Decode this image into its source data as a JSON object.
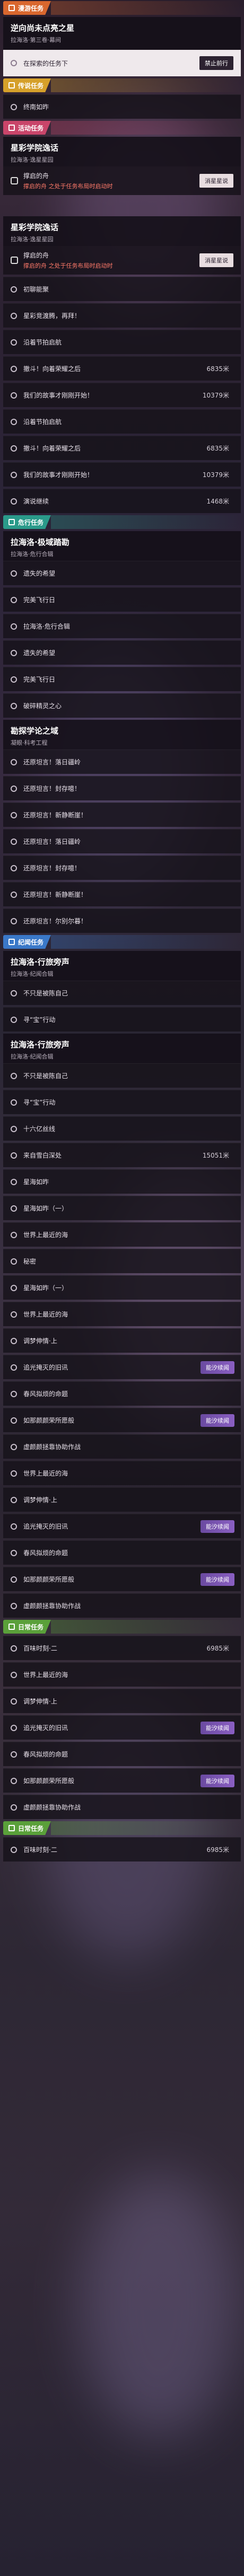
{
  "categories": {
    "explore": "漫游任务",
    "legend": "传说任务",
    "event": "活动任务",
    "urgent": "危行任务",
    "daily": "日常任务",
    "reconnaissance": "纪闻任务"
  },
  "explore_main": {
    "title": "逆向尚未点亮之星",
    "subtitle": "拉海洛·第三卷·幕间",
    "selected": "在探索的任务下",
    "selected_btn": "禁止前行"
  },
  "legend_item": "终南如昨",
  "event_main": {
    "title": "星彩学院逸话",
    "subtitle": "拉海洛·逸星星园"
  },
  "event_sub": {
    "label": "撑启的舟",
    "warn": "撑启的舟 之处于任务布局时启动时",
    "btn": "消星星说"
  },
  "event_main2": {
    "title": "星彩学院逸话",
    "subtitle": "拉海洛·逸星星园"
  },
  "event_sub2": {
    "label": "撑启的舟",
    "warn": "撑启的舟 之处于任务布局时启动时",
    "btn": "消星星说"
  },
  "event_items": [
    {
      "text": "初聊能聚"
    },
    {
      "text": "星彩竞渡腾，再拜！"
    },
    {
      "text": "沿着节拍启航"
    },
    {
      "text": "撤斗！向着荣耀之后",
      "dist": "6835米"
    },
    {
      "text": "我们的故事才刚刚开始！",
      "dist": "10379米"
    },
    {
      "text": "沿着节拍启航"
    },
    {
      "text": "撤斗！向着荣耀之后",
      "dist": "6835米"
    },
    {
      "text": "我们的故事才刚刚开始！",
      "dist": "10379米"
    },
    {
      "text": "演说继续",
      "dist": "1468米"
    }
  ],
  "urgent_main": {
    "title": "拉海洛·极域踏勘",
    "subtitle": "拉海洛·危行合辑"
  },
  "urgent_items": [
    {
      "text": "遗失的希望"
    },
    {
      "text": "完美飞行日"
    },
    {
      "text": "拉海洛·危行合辑"
    },
    {
      "text": "遗失的希望"
    },
    {
      "text": "完美飞行日"
    },
    {
      "text": "破碎精灵之心"
    }
  ],
  "urgent_main2": {
    "title": "勘探学论之域",
    "subtitle": "凝眼·科考工程"
  },
  "urgent_items2": [
    {
      "text": "还原坦言！落日疆岭"
    },
    {
      "text": "还原坦言！封存噫！"
    },
    {
      "text": "还原坦言！新静断崖！"
    },
    {
      "text": "还原坦言！落日疆岭"
    },
    {
      "text": "还原坦言！封存噫！"
    },
    {
      "text": "还原坦言！新静断崖！"
    },
    {
      "text": "还原坦言！尔别尔暮！"
    }
  ],
  "recon_main": {
    "title": "拉海洛·行旅旁声",
    "subtitle": "拉海洛·纪闻合辑"
  },
  "recon_items": [
    {
      "text": "不只是被陈自己"
    },
    {
      "text": "寻“宝”行动"
    }
  ],
  "recon_main2": {
    "title": "拉海洛·行旅旁声",
    "subtitle": "拉海洛·纪闻合辑"
  },
  "recon_items2": [
    {
      "text": "不只是被陈自己"
    },
    {
      "text": "寻“宝”行动"
    },
    {
      "text": "十六亿丝线"
    },
    {
      "text": "来自雪白深处",
      "dist": "15051米"
    },
    {
      "text": "星海如昨"
    },
    {
      "text": "星海如昨（一）"
    },
    {
      "text": "世界上最近的海"
    },
    {
      "text": "秘密"
    },
    {
      "text": "星海如昨（一）"
    },
    {
      "text": "世界上最近的海"
    },
    {
      "text": "调梦伸情·上"
    },
    {
      "text": "追光掩灭的旧讯",
      "badge": "能汐续闻"
    },
    {
      "text": "春风拟烦的命题"
    },
    {
      "text": "如那颜颜荣所愿般",
      "badge": "能汐续闻"
    },
    {
      "text": "虚颜颜拯靠协助作战"
    },
    {
      "text": "世界上最近的海"
    },
    {
      "text": "调梦伸情·上"
    },
    {
      "text": "追光掩灭的旧讯",
      "badge": "能汐续闻"
    },
    {
      "text": "春风拟烦的命题"
    },
    {
      "text": "如那颜颜荣所愿般",
      "badge": "能汐续闻"
    },
    {
      "text": "虚颜颜拯靠协助作战"
    }
  ],
  "daily_items": [
    {
      "text": "百味时刻·二",
      "dist": "6985米"
    }
  ],
  "daily_items2": [
    {
      "text": "世界上最近的海"
    },
    {
      "text": "调梦伸情·上"
    },
    {
      "text": "追光掩灭的旧讯",
      "badge": "能汐续闻"
    },
    {
      "text": "春风拟烦的命题"
    },
    {
      "text": "如那颜颜荣所愿般",
      "badge": "能汐续闻"
    },
    {
      "text": "虚颜颜拯靠协助作战"
    }
  ],
  "daily_items3": [
    {
      "text": "百味时刻·二",
      "dist": "6985米"
    }
  ]
}
